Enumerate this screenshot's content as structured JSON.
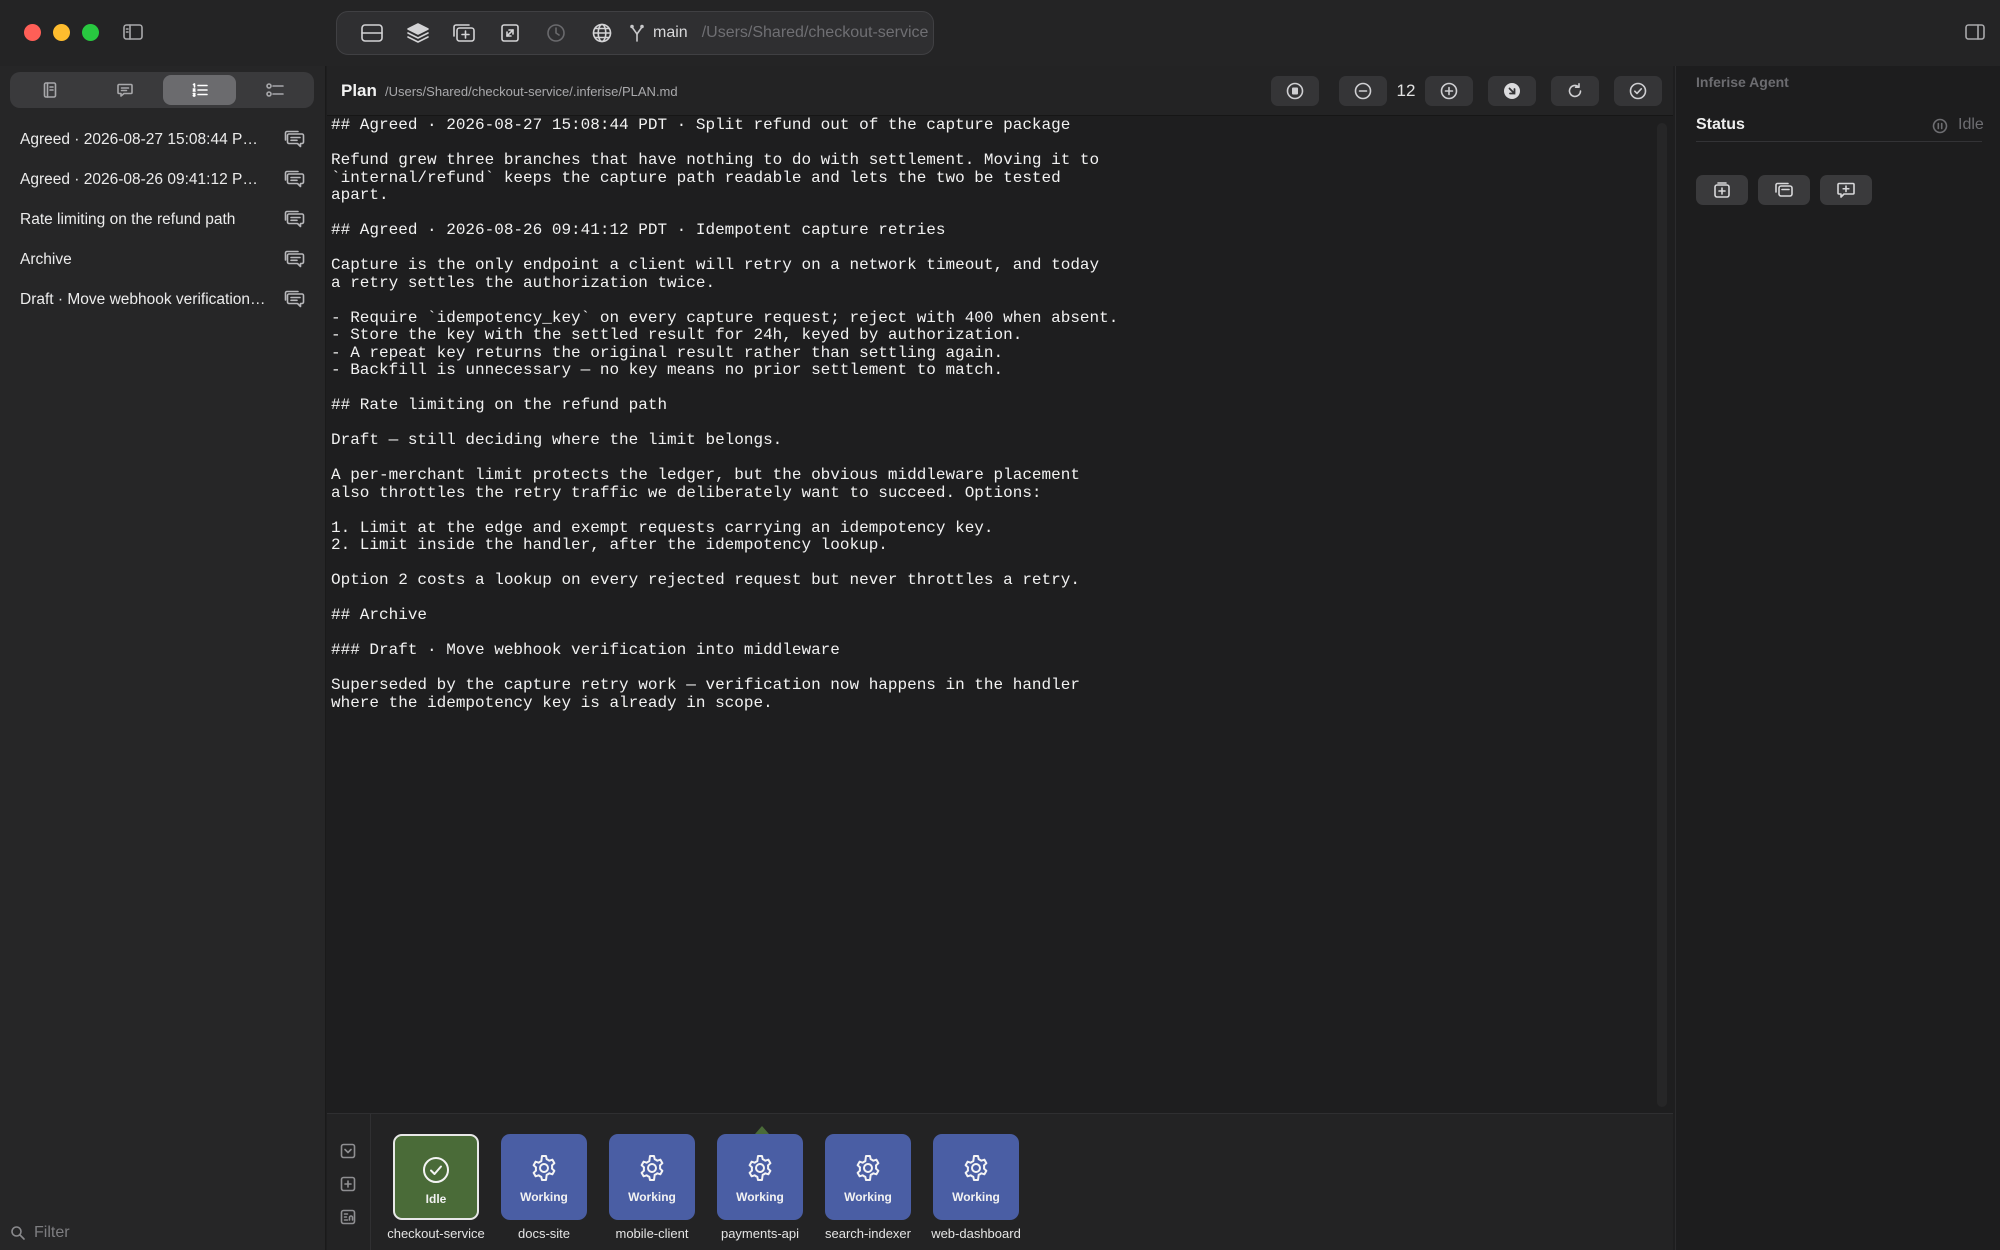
{
  "toolbar": {
    "branch": "main",
    "repo_path": "/Users/Shared/checkout-service"
  },
  "sidebar": {
    "items": [
      {
        "label": "Agreed · 2026-08-27 15:08:44 PDT · Split refund out of the capture package"
      },
      {
        "label": "Agreed · 2026-08-26 09:41:12 PDT · Idempotent capture retries"
      },
      {
        "label": "Rate limiting on the refund path"
      },
      {
        "label": "Archive"
      },
      {
        "label": "Draft · Move webhook verification into middleware"
      }
    ],
    "filter_placeholder": "Filter"
  },
  "editor": {
    "title": "Plan",
    "path": "/Users/Shared/checkout-service/.inferise/PLAN.md",
    "font_size": "12",
    "content": "## Agreed · 2026-08-27 15:08:44 PDT · Split refund out of the capture package\n\nRefund grew three branches that have nothing to do with settlement. Moving it to\n`internal/refund` keeps the capture path readable and lets the two be tested\napart.\n\n## Agreed · 2026-08-26 09:41:12 PDT · Idempotent capture retries\n\nCapture is the only endpoint a client will retry on a network timeout, and today\na retry settles the authorization twice.\n\n- Require `idempotency_key` on every capture request; reject with 400 when absent.\n- Store the key with the settled result for 24h, keyed by authorization.\n- A repeat key returns the original result rather than settling again.\n- Backfill is unnecessary — no key means no prior settlement to match.\n\n## Rate limiting on the refund path\n\nDraft — still deciding where the limit belongs.\n\nA per-merchant limit protects the ledger, but the obvious middleware placement\nalso throttles the retry traffic we deliberately want to succeed. Options:\n\n1. Limit at the edge and exempt requests carrying an idempotency key.\n2. Limit inside the handler, after the idempotency lookup.\n\nOption 2 costs a lookup on every rejected request but never throttles a retry.\n\n## Archive\n\n### Draft · Move webhook verification into middleware\n\nSuperseded by the capture retry work — verification now happens in the handler\nwhere the idempotency key is already in scope."
  },
  "agents": [
    {
      "name": "checkout-service",
      "status": "Idle",
      "icon": "check-circle-icon"
    },
    {
      "name": "docs-site",
      "status": "Working",
      "icon": "gear-icon"
    },
    {
      "name": "mobile-client",
      "status": "Working",
      "icon": "gear-icon"
    },
    {
      "name": "payments-api",
      "status": "Working",
      "icon": "gear-icon"
    },
    {
      "name": "search-indexer",
      "status": "Working",
      "icon": "gear-icon"
    },
    {
      "name": "web-dashboard",
      "status": "Working",
      "icon": "gear-icon"
    }
  ],
  "right_panel": {
    "title": "Inferise Agent",
    "status_label": "Status",
    "status_value": "Idle"
  },
  "colors": {
    "background": "#1e1e1f",
    "working_tile": "#4a5ea4",
    "idle_tile": "#4a6b38",
    "close": "#ff5f57",
    "minimize": "#febc2e",
    "zoom": "#28c840"
  }
}
